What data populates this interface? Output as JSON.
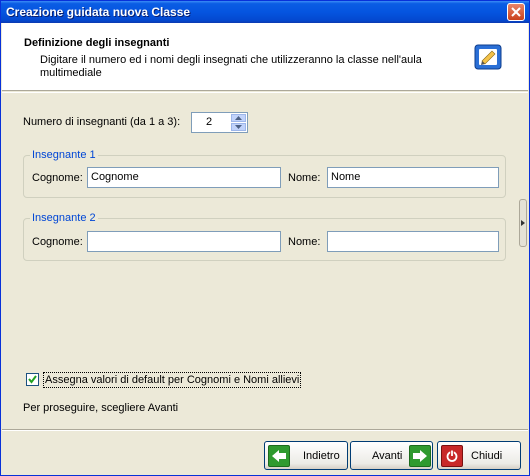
{
  "window": {
    "title": "Creazione guidata nuova Classe"
  },
  "header": {
    "title": "Definizione degli insegnanti",
    "subtitle": "Digitare il numero ed i nomi degli insegnati che utilizzeranno la classe nell'aula multimediale",
    "icon": "wizard-class-icon"
  },
  "count": {
    "label": "Numero di insegnanti (da 1 a 3):",
    "value": "2"
  },
  "teachers": [
    {
      "legend": "Insegnante 1",
      "surname_label": "Cognome:",
      "surname_value": "Cognome",
      "name_label": "Nome:",
      "name_value": "Nome"
    },
    {
      "legend": "Insegnante 2",
      "surname_label": "Cognome:",
      "surname_value": "",
      "name_label": "Nome:",
      "name_value": ""
    }
  ],
  "defaults_checkbox": {
    "label": "Assegna valori di default per Cognomi e Nomi allievi",
    "checked": true
  },
  "hint": "Per proseguire, scegliere Avanti",
  "buttons": {
    "back": "Indietro",
    "next": "Avanti",
    "close": "Chiudi"
  },
  "colors": {
    "titlebar": "#0555e0",
    "groupLegend": "#0046d5",
    "arrowGreen": "#2f9a2f",
    "closeRed": "#c82828"
  }
}
